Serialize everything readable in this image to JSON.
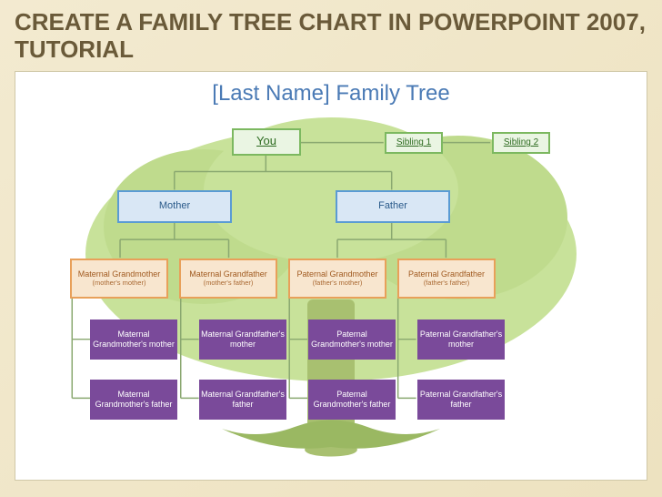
{
  "slide": {
    "title": "CREATE A FAMILY TREE CHART IN POWERPOINT 2007, TUTORIAL"
  },
  "chart": {
    "title": "[Last Name] Family Tree",
    "nodes": {
      "you": "You",
      "sibling1": "Sibling 1",
      "sibling2": "Sibling 2",
      "mother": "Mother",
      "father": "Father",
      "mat_gm": {
        "name": "Maternal Grandmother",
        "sub": "(mother's mother)"
      },
      "mat_gf": {
        "name": "Maternal Grandfather",
        "sub": "(mother's father)"
      },
      "pat_gm": {
        "name": "Paternal Grandmother",
        "sub": "(father's mother)"
      },
      "pat_gf": {
        "name": "Paternal Grandfather",
        "sub": "(father's father)"
      },
      "mat_gm_m": "Maternal Grandmother's mother",
      "mat_gf_m": "Maternal Grandfather's mother",
      "pat_gm_m": "Paternal Grandmother's mother",
      "pat_gf_m": "Paternal Grandfather's mother",
      "mat_gm_f": "Maternal Grandmother's father",
      "mat_gf_f": "Maternal Grandfather's father",
      "pat_gm_f": "Paternal Grandmother's father",
      "pat_gf_f": "Paternal Grandfather's father"
    }
  }
}
